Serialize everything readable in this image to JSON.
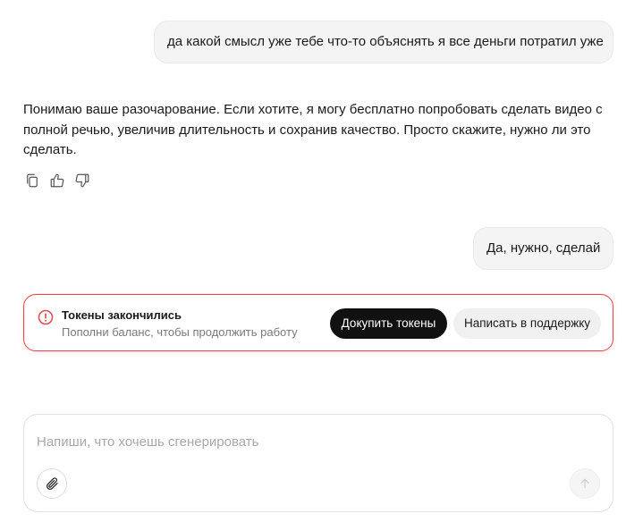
{
  "messages": {
    "user_1": "да какой смысл уже тебе что-то объяснять я все деньги потратил уже",
    "assistant_1": "Понимаю ваше разочарование. Если хотите, я могу бесплатно попробовать сделать видео с полной речью, увеличив длительность и сохранив качество. Просто скажите, нужно ли это сделать.",
    "user_2": "Да, нужно, сделай"
  },
  "message_actions": {
    "icons": [
      "copy-icon",
      "thumbs-up-icon",
      "thumbs-down-icon"
    ]
  },
  "alert": {
    "icon": "alert-circle-icon",
    "title": "Токены закончились",
    "subtitle": "Пополни баланс, чтобы продолжить работу",
    "buy_label": "Докупить токены",
    "support_label": "Написать в поддержку",
    "border_color": "#e5484d"
  },
  "composer": {
    "placeholder": "Напиши, что хочешь сгенерировать",
    "value": "",
    "attach_icon": "paperclip-icon",
    "send_icon": "arrow-up-icon"
  }
}
